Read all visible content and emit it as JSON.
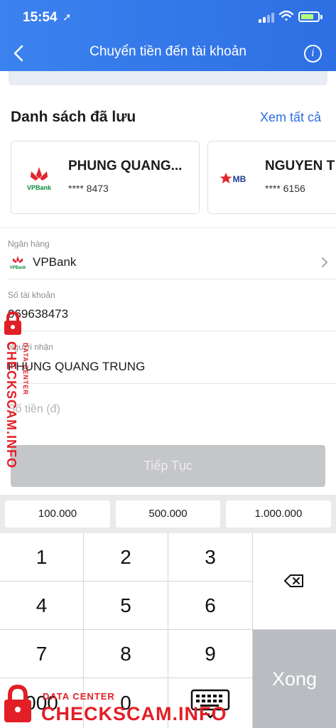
{
  "status_bar": {
    "time": "15:54",
    "location_glyph": "➚"
  },
  "nav": {
    "title": "Chuyển tiền đến tài khoản",
    "info_label": "i"
  },
  "saved": {
    "title": "Danh sách đã lưu",
    "see_all": "Xem tất cả",
    "items": [
      {
        "bank_logo_text": "VPBank",
        "name": "PHUNG QUANG...",
        "account": "**** 8473"
      },
      {
        "bank_logo_text": "MB",
        "name": "NGUYEN T",
        "account": "**** 6156"
      }
    ]
  },
  "form": {
    "bank": {
      "label": "Ngân hàng",
      "value": "VPBank",
      "logo_text": "VPBank"
    },
    "account_number": {
      "label": "Số tài khoản",
      "value": "069638473"
    },
    "recipient": {
      "label": "Người nhận",
      "value": "PHUNG QUANG TRUNG"
    },
    "amount": {
      "placeholder": "Số tiền (đ)"
    },
    "continue_label": "Tiếp Tục"
  },
  "quick_amounts": [
    "100.000",
    "500.000",
    "1.000.000"
  ],
  "keypad": {
    "keys": [
      "1",
      "2",
      "3",
      "4",
      "5",
      "6",
      "7",
      "8",
      "9",
      "000",
      "0"
    ],
    "done_label": "Xong"
  },
  "watermark": {
    "brand": "CHECKSCAM.INFO",
    "sub": "DATA CENTER"
  },
  "colors": {
    "header": "#3b82ef",
    "accent": "#2c6fe0",
    "button_disabled": "#c5c6c9",
    "watermark": "#e21f26"
  }
}
